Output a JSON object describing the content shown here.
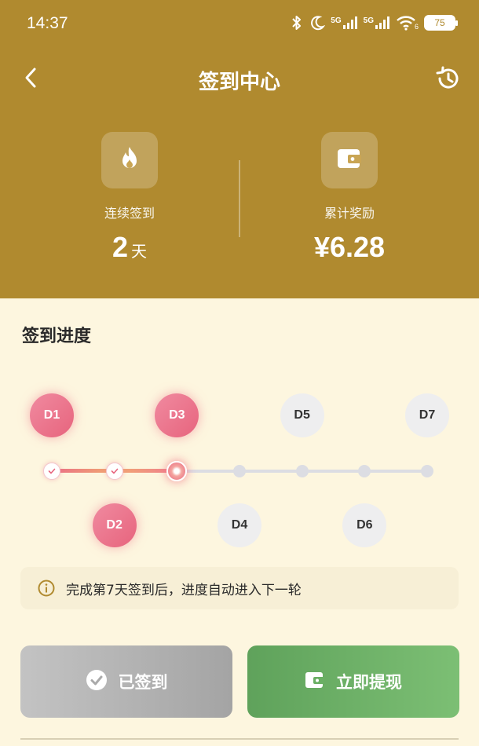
{
  "status_bar": {
    "time": "14:37",
    "signal_1": "5G",
    "signal_2": "5G",
    "wifi_number": "6",
    "battery": "75"
  },
  "nav": {
    "title": "签到中心",
    "back_icon": "chevron-left-icon",
    "history_icon": "history-icon"
  },
  "stats": {
    "streak": {
      "label": "连续签到",
      "value": "2",
      "unit": "天",
      "icon": "flame-icon"
    },
    "reward": {
      "label": "累计奖励",
      "value": "¥6.28",
      "icon": "wallet-icon"
    }
  },
  "progress": {
    "title": "签到进度",
    "days": [
      {
        "label": "D1",
        "status": "done"
      },
      {
        "label": "D2",
        "status": "done"
      },
      {
        "label": "D3",
        "status": "done"
      },
      {
        "label": "D4",
        "status": "pending"
      },
      {
        "label": "D5",
        "status": "pending"
      },
      {
        "label": "D6",
        "status": "pending"
      },
      {
        "label": "D7",
        "status": "pending"
      }
    ],
    "completed_days": 3,
    "total_days": 7
  },
  "tip": {
    "icon": "info-icon",
    "text": "完成第7天签到后，进度自动进入下一轮"
  },
  "buttons": {
    "signed": {
      "label": "已签到",
      "icon": "check-circle-icon"
    },
    "withdraw": {
      "label": "立即提现",
      "icon": "wallet-icon"
    }
  },
  "colors": {
    "header_bg": "#b08a2f",
    "page_bg": "#fdf6df",
    "accent_pink": "#e7647d",
    "withdraw_green": "#6aaf64",
    "signed_gray": "#b3b3b3"
  }
}
